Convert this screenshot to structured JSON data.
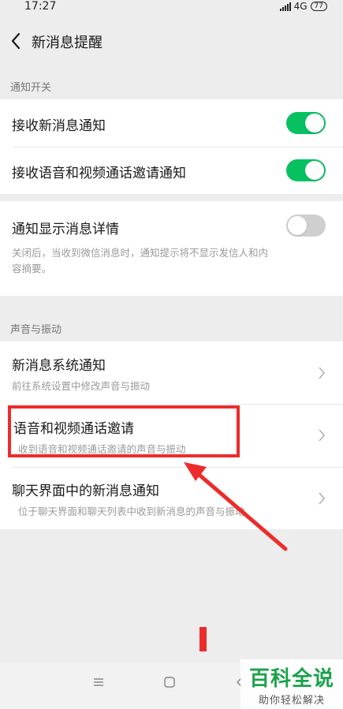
{
  "status_bar": {
    "time": "17:27",
    "network": "4G",
    "battery": "77"
  },
  "header": {
    "title": "新消息提醒"
  },
  "section_notify": {
    "label": "通知开关"
  },
  "toggles": [
    {
      "label": "接收新消息通知",
      "state": "on"
    },
    {
      "label": "接收语音和视频通话邀请通知",
      "state": "on"
    }
  ],
  "detail": {
    "label": "通知显示消息详情",
    "state": "off",
    "desc_line1": "关闭后，当收到微信消息时，通知提示将不显示发信人和内",
    "desc_line2": "容摘要。"
  },
  "section_sound": {
    "label": "声音与振动"
  },
  "sound_items": [
    {
      "label": "新消息系统通知",
      "desc": "前往系统设置中修改声音与振动"
    },
    {
      "label": "语音和视频通话邀请",
      "desc": "收到语音和视频通话邀请的声音与振动"
    },
    {
      "label": "聊天界面中的新消息通知",
      "desc": "位于聊天界面和聊天列表中收到新消息的声音与振动"
    }
  ],
  "watermark": {
    "title": "百科全说",
    "subtitle": "助你轻松解决"
  },
  "colors": {
    "toggle_on": "#07c160",
    "toggle_off": "#cfcfcf",
    "annotation": "#ee2b2b",
    "brand_green": "#1aa34a"
  }
}
